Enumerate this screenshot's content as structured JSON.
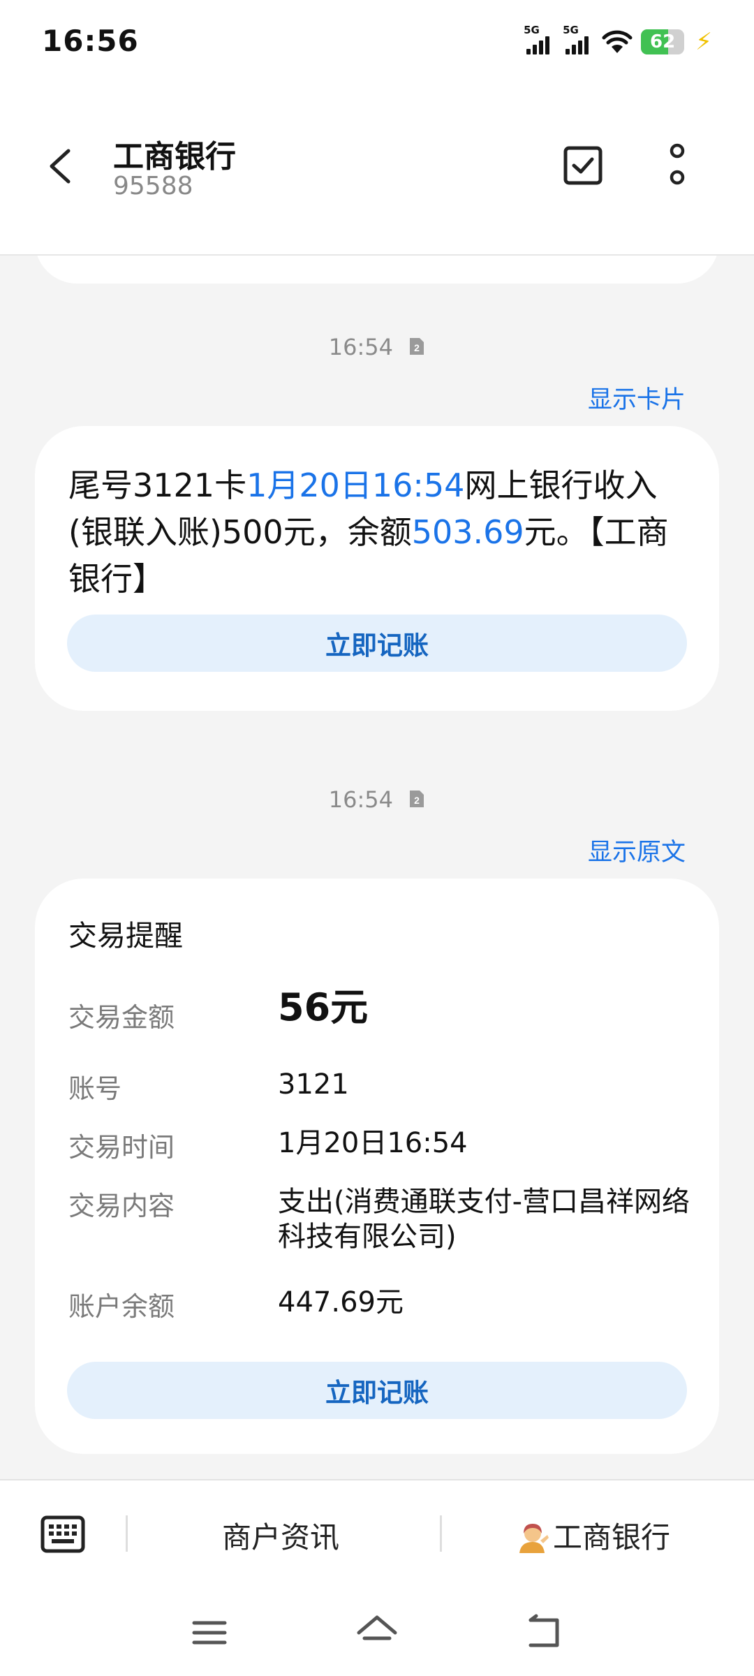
{
  "status": {
    "time": "16:56",
    "sim1": "5G",
    "sim2": "5G",
    "battery": "62",
    "battery_level": 0.62
  },
  "header": {
    "title": "工商银行",
    "number": "95588"
  },
  "messages": [
    {
      "time": "16:54",
      "toggle": "显示卡片",
      "text_parts": [
        "尾号3121卡",
        "1月20日16:54",
        "网上银行收入(银联入账)500元，余额",
        "503.69",
        "元。【工商银行】"
      ],
      "action": "立即记账"
    },
    {
      "time": "16:54",
      "toggle": "显示原文",
      "card_title": "交易提醒",
      "rows": [
        {
          "key": "交易金额",
          "value": "56元"
        },
        {
          "key": "账号",
          "value": "3121"
        },
        {
          "key": "交易时间",
          "value": "1月20日16:54"
        },
        {
          "key": "交易内容",
          "value": "支出(消费通联支付-营口昌祥网络科技有限公司)"
        },
        {
          "key": "账户余额",
          "value": "447.69元"
        }
      ],
      "action": "立即记账"
    }
  ],
  "bottom": {
    "menu1": "商户资讯",
    "menu2": "工商银行"
  },
  "icons": {
    "back": "back-arrow-icon",
    "select": "checkbox-icon",
    "more": "more-vertical-icon",
    "keyboard": "keyboard-icon",
    "sim": "sim-2-icon",
    "person": "person-tipping-hand-icon"
  },
  "colors": {
    "link": "#1a73e8",
    "button_bg": "#e4f0fc",
    "button_text": "#1565c0",
    "battery": "#41c153"
  }
}
